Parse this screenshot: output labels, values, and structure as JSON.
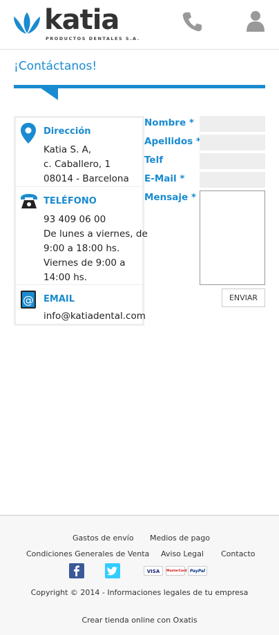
{
  "header": {
    "logo_name": "katia",
    "logo_subtitle": "PRODUCTOS DENTALES S.A.",
    "icons": [
      "phone-icon",
      "user-icon"
    ]
  },
  "page": {
    "title": "¡Contáctanos!"
  },
  "contact": {
    "address": {
      "title": "Dirección",
      "lines": [
        "Katia S. A,",
        "c. Caballero, 1",
        "08014 - Barcelona"
      ]
    },
    "phone": {
      "title": "TELÉFONO",
      "lines": [
        "93 409 06 00",
        "De lunes a viernes, de",
        "9:00 a 18:00 hs.",
        "Viernes de 9:00 a",
        "14:00 hs."
      ]
    },
    "email": {
      "title": "EMAIL",
      "lines": [
        "info@katiadental.com"
      ]
    }
  },
  "form": {
    "name_label": "Nombre *",
    "surname_label": "Apellidos *",
    "phone_label": "Telf",
    "email_label": "E-Mail *",
    "message_label": "Mensaje *",
    "submit_label": "ENVIAR"
  },
  "footer": {
    "links": {
      "shipping": "Gastos de envío",
      "payment": "Medios de pago",
      "terms": "Condiciones Generales de Venta",
      "legal": "Aviso Legal",
      "contact": "Contacto"
    },
    "payment_badges": [
      "VISA",
      "MasterCard",
      "PayPal"
    ],
    "copyright": "Copyright © 2014 - Informaciones legales de tu empresa",
    "powered_by": "Crear tienda online con Oxatis"
  },
  "colors": {
    "accent": "#1a8bd0",
    "text": "#222222",
    "footer_bg": "#f7f7f7"
  }
}
